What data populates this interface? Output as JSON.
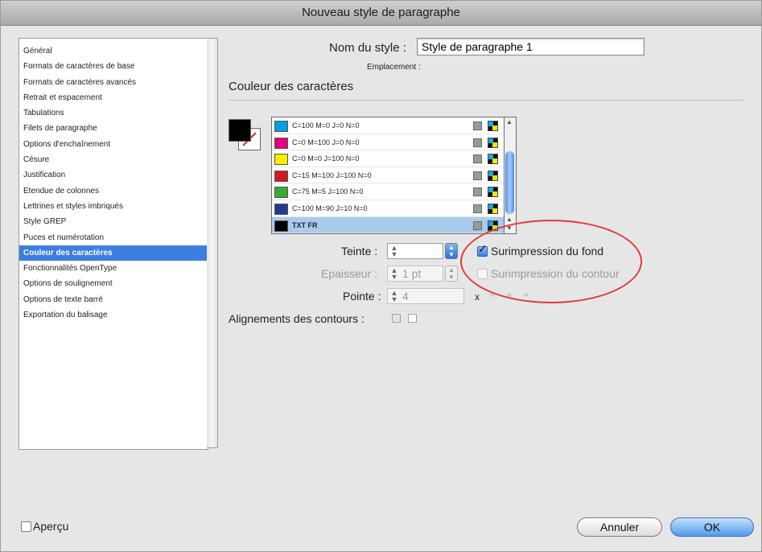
{
  "window": {
    "title": "Nouveau style de paragraphe"
  },
  "sidebar": {
    "items": [
      {
        "label": "Général"
      },
      {
        "label": "Formats de caractères de base"
      },
      {
        "label": "Formats de caractères avancés"
      },
      {
        "label": "Retrait et espacement"
      },
      {
        "label": "Tabulations"
      },
      {
        "label": "Filets de paragraphe"
      },
      {
        "label": "Options d'enchaînement"
      },
      {
        "label": "Césure"
      },
      {
        "label": "Justification"
      },
      {
        "label": "Etendue de colonnes"
      },
      {
        "label": "Lettrines et styles imbriqués"
      },
      {
        "label": "Style GREP"
      },
      {
        "label": "Puces et numérotation"
      },
      {
        "label": "Couleur des caractères",
        "selected": true
      },
      {
        "label": "Fonctionnalités OpenType"
      },
      {
        "label": "Options de soulignement"
      },
      {
        "label": "Options de texte barré"
      },
      {
        "label": "Exportation du balisage"
      }
    ]
  },
  "style_name": {
    "label": "Nom du style :",
    "value": "Style de paragraphe 1"
  },
  "location": {
    "label": "Emplacement :"
  },
  "section": {
    "title": "Couleur des caractères"
  },
  "swatches": [
    {
      "name": "C=100 M=0 J=0 N=0",
      "color": "#00a0e3"
    },
    {
      "name": "C=0 M=100 J=0 N=0",
      "color": "#e4007d"
    },
    {
      "name": "C=0 M=0 J=100 N=0",
      "color": "#ffec00"
    },
    {
      "name": "C=15 M=100 J=100 N=0",
      "color": "#d4181f"
    },
    {
      "name": "C=75 M=5 J=100 N=0",
      "color": "#3aa935"
    },
    {
      "name": "C=100 M=90 J=10 N=0",
      "color": "#213b8e"
    },
    {
      "name": "TXT FR",
      "color": "#000000",
      "selected": true
    }
  ],
  "tint": {
    "label": "Teinte :",
    "value": ""
  },
  "weight": {
    "label": "Epaisseur :",
    "value": "1 pt"
  },
  "miter": {
    "label": "Pointe :",
    "value": "4",
    "suffix": "x"
  },
  "stroke_alignment": {
    "label": "Alignements des contours :"
  },
  "overprint_fill": {
    "label": "Surimpression du fond",
    "checked": true
  },
  "overprint_stroke": {
    "label": "Surimpression du contour",
    "checked": false
  },
  "preview": {
    "label": "Aperçu",
    "checked": false
  },
  "buttons": {
    "cancel": "Annuler",
    "ok": "OK"
  },
  "colors": {
    "selection": "#3d7fe1",
    "highlight_ellipse": "#e03a3a"
  }
}
